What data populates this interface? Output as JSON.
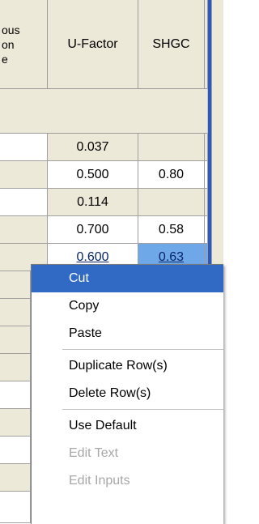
{
  "table": {
    "headers": {
      "partial_left": "ous\non\ne",
      "ufactor": "U-Factor",
      "shgc": "SHGC"
    },
    "rows": [
      {
        "ufactor": "0.037",
        "shgc": ""
      },
      {
        "ufactor": "0.500",
        "shgc": "0.80"
      },
      {
        "ufactor": "0.114",
        "shgc": ""
      },
      {
        "ufactor": "0.700",
        "shgc": "0.58"
      },
      {
        "ufactor": "0.600",
        "shgc": "0.63"
      }
    ]
  },
  "context_menu": {
    "items": [
      {
        "label": "Cut"
      },
      {
        "label": "Copy"
      },
      {
        "label": "Paste"
      },
      {
        "label": "Duplicate Row(s)"
      },
      {
        "label": "Delete Row(s)"
      },
      {
        "label": "Use Default"
      },
      {
        "label": "Edit Text"
      },
      {
        "label": "Edit Inputs"
      }
    ]
  },
  "colors": {
    "highlight": "#316ac5",
    "selected_cell": "#6fa8e8",
    "grid_background": "#ece9d8",
    "separator_bar": "#2b59c3"
  }
}
